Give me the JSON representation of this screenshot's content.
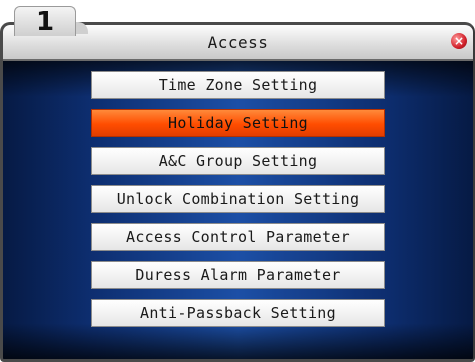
{
  "step": {
    "number": "1"
  },
  "window": {
    "title": "Access",
    "close_icon": "close-icon"
  },
  "menu": {
    "selected_index": 1,
    "items": [
      {
        "label": "Time Zone Setting"
      },
      {
        "label": "Holiday Setting"
      },
      {
        "label": "A&C Group Setting"
      },
      {
        "label": "Unlock Combination Setting"
      },
      {
        "label": "Access Control Parameter"
      },
      {
        "label": "Duress Alarm Parameter"
      },
      {
        "label": "Anti-Passback Setting"
      }
    ]
  },
  "colors": {
    "selected_item": "#ff5a0a",
    "screen_background": "#1c4fa6",
    "close_button": "#d1202a"
  }
}
